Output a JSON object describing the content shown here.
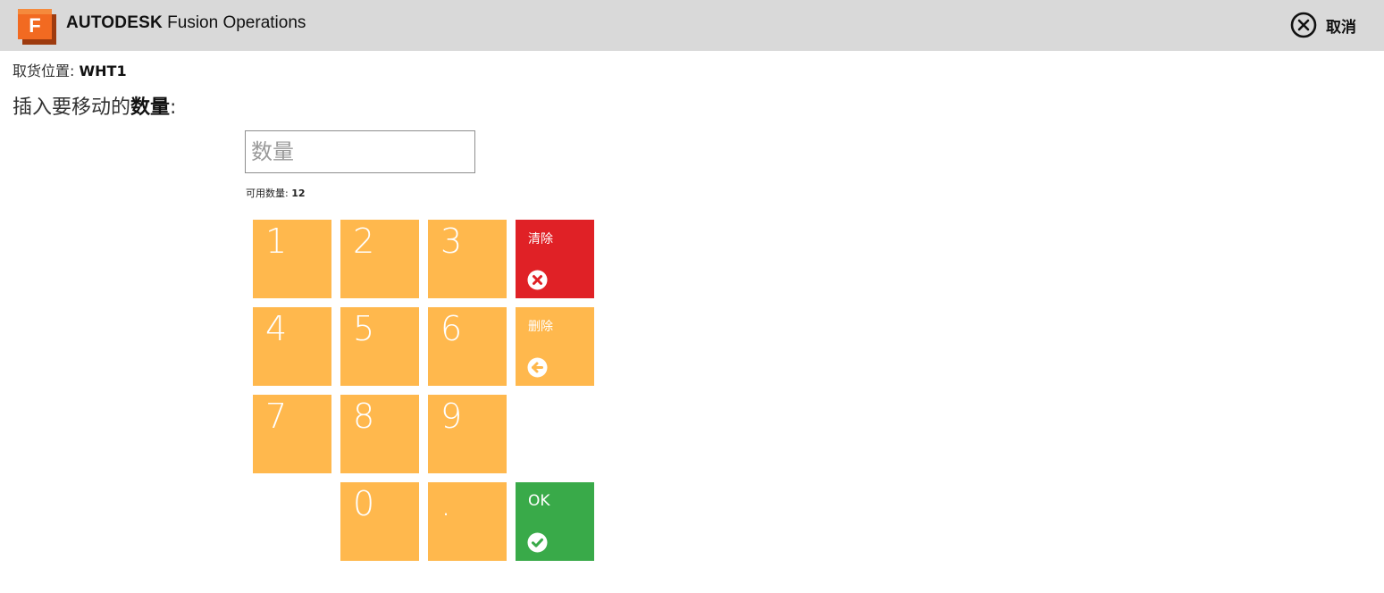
{
  "header": {
    "logo_letter": "F",
    "brand_bold": "AUTODESK",
    "brand_rest": " Fusion Operations",
    "cancel_label": "取消",
    "cancel_icon": "close-circle-icon"
  },
  "location": {
    "label": "取货位置: ",
    "value": "WHT1"
  },
  "instruction": {
    "prefix": "插入要移动的",
    "bold": "数量",
    "suffix": ":"
  },
  "quantity_input": {
    "value": "",
    "placeholder": "数量"
  },
  "available": {
    "label": "可用数量: ",
    "value": "12"
  },
  "keypad": {
    "digits": [
      "1",
      "2",
      "3",
      "4",
      "5",
      "6",
      "7",
      "8",
      "9",
      "0",
      "."
    ],
    "clear_label": "清除",
    "clear_icon": "close-circle-icon",
    "delete_label": "删除",
    "delete_icon": "arrow-left-circle-icon",
    "ok_label": "OK",
    "ok_icon": "check-circle-icon"
  },
  "colors": {
    "header_bg": "#d9d9d9",
    "key_orange": "#ffb84d",
    "clear_red": "#e02126",
    "ok_green": "#39aa49",
    "logo_orange": "#f26a21"
  }
}
